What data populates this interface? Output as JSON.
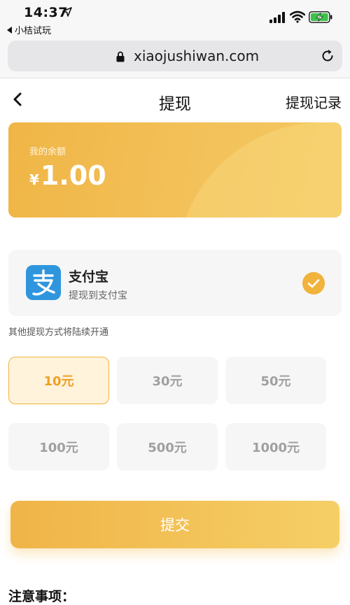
{
  "status": {
    "time": "14:37",
    "back_app": "小桔试玩",
    "icons": [
      "location-arrow-icon",
      "signal-icon",
      "wifi-icon",
      "battery-charging-icon"
    ]
  },
  "browser": {
    "url": "xiaojushiwan.com",
    "icons": [
      "lock-icon",
      "reload-icon"
    ]
  },
  "nav": {
    "title": "提现",
    "record_label": "提现记录"
  },
  "balance": {
    "label": "我的余额",
    "currency": "¥",
    "amount": "1.00"
  },
  "payment": {
    "name": "支付宝",
    "description": "提现到支付宝",
    "logo_char": "支",
    "selected": true
  },
  "other_methods_note": "其他提现方式将陆续开通",
  "amounts": [
    {
      "label": "10元",
      "selected": true
    },
    {
      "label": "30元",
      "selected": false
    },
    {
      "label": "50元",
      "selected": false
    },
    {
      "label": "100元",
      "selected": false
    },
    {
      "label": "500元",
      "selected": false
    },
    {
      "label": "1000元",
      "selected": false
    }
  ],
  "submit_label": "提交",
  "notes_title": "注意事项：",
  "colors": {
    "accent": "#f0b33c",
    "card_gradient_start": "#f0b546",
    "card_gradient_end": "#f4c862",
    "alipay_blue": "#2f96de"
  }
}
